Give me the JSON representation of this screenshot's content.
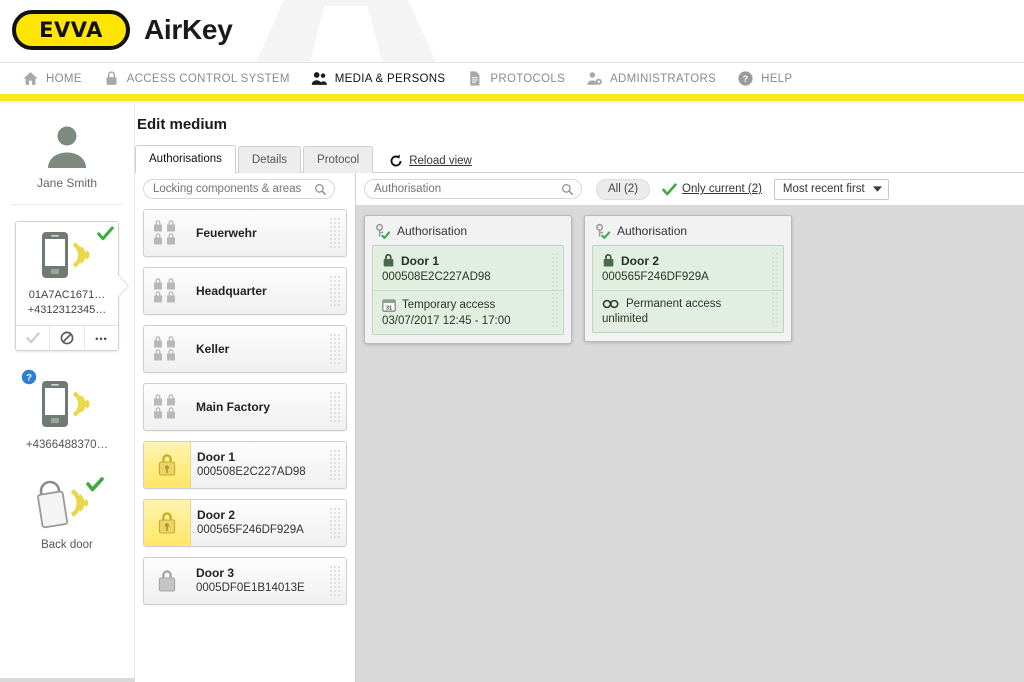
{
  "header": {
    "logo_text": "EVVA",
    "app_title": "AirKey"
  },
  "nav": {
    "items": [
      {
        "label": "HOME",
        "icon": "home-icon",
        "active": false
      },
      {
        "label": "ACCESS CONTROL SYSTEM",
        "icon": "lock-icon",
        "active": false
      },
      {
        "label": "MEDIA & PERSONS",
        "icon": "people-icon",
        "active": true
      },
      {
        "label": "PROTOCOLS",
        "icon": "document-icon",
        "active": false
      },
      {
        "label": "ADMINISTRATORS",
        "icon": "admin-user-icon",
        "active": false
      },
      {
        "label": "HELP",
        "icon": "help-icon",
        "active": false
      }
    ]
  },
  "sidebar": {
    "person_name": "Jane Smith",
    "selected_device": {
      "id_line": "01A7AC1671…",
      "phone_line": "+4312312345…",
      "status_icon": "green-check-icon",
      "actions": [
        {
          "name": "confirm-button",
          "icon": "check-icon",
          "disabled": true
        },
        {
          "name": "block-button",
          "icon": "block-icon",
          "disabled": false
        },
        {
          "name": "more-options-button",
          "icon": "ellipsis-icon",
          "disabled": false
        }
      ]
    },
    "devices": [
      {
        "caption": "+4366488370…",
        "icon": "phone-nfc-icon",
        "badge": "question-badge-icon"
      },
      {
        "caption": "Back door",
        "icon": "keyfob-nfc-icon",
        "badge": "green-check-icon"
      }
    ]
  },
  "main": {
    "page_title": "Edit medium",
    "tabs": [
      {
        "label": "Authorisations",
        "active": true
      },
      {
        "label": "Details",
        "active": false
      },
      {
        "label": "Protocol",
        "active": false
      }
    ],
    "reload_label": "Reload view",
    "reload_icon": "refresh-icon"
  },
  "left_pane": {
    "search_placeholder": "Locking components & areas",
    "search_value": "",
    "search_icon": "search-icon",
    "items": [
      {
        "name": "Feuerwehr",
        "code": "",
        "type": "area",
        "icon": "multi-lock-icon",
        "highlighted": false
      },
      {
        "name": "Headquarter",
        "code": "",
        "type": "area",
        "icon": "multi-lock-icon",
        "highlighted": false
      },
      {
        "name": "Keller",
        "code": "",
        "type": "area",
        "icon": "multi-lock-icon",
        "highlighted": false
      },
      {
        "name": "Main Factory",
        "code": "",
        "type": "area",
        "icon": "multi-lock-icon",
        "highlighted": false
      },
      {
        "name": "Door 1",
        "code": "000508E2C227AD98",
        "type": "component",
        "icon": "lock-icon",
        "highlighted": true
      },
      {
        "name": "Door 2",
        "code": "000565F246DF929A",
        "type": "component",
        "icon": "lock-icon",
        "highlighted": true
      },
      {
        "name": "Door 3",
        "code": "0005DF0E1B14013E",
        "type": "component",
        "icon": "lock-icon",
        "highlighted": false
      }
    ]
  },
  "toolbar": {
    "search_placeholder": "Authorisation",
    "search_value": "",
    "search_icon": "search-icon",
    "filter_all": "All (2)",
    "filter_current": "Only current (2)",
    "filter_current_icon": "green-check-icon",
    "sort_value": "Most recent first",
    "sort_icon": "chevron-down-icon"
  },
  "authorisations": [
    {
      "header": "Authorisation",
      "header_icon": "key-check-icon",
      "door_name": "Door 1",
      "door_icon": "lock-icon",
      "door_code": "000508E2C227AD98",
      "access_type": "Temporary access",
      "access_icon": "calendar-icon",
      "access_value": "03/07/2017 12:45 - 17:00"
    },
    {
      "header": "Authorisation",
      "header_icon": "key-check-icon",
      "door_name": "Door 2",
      "door_icon": "lock-icon",
      "door_code": "000565F246DF929A",
      "access_type": "Permanent access",
      "access_icon": "infinity-icon",
      "access_value": "unlimited"
    }
  ],
  "colors": {
    "brand_yellow": "#ffe820",
    "logo_yellow": "#ffe600",
    "canvas_grey": "#d9d9d9",
    "auth_green": "#e2eee2",
    "highlight_yellow": "#ffe766",
    "status_green": "#3faa3f"
  }
}
